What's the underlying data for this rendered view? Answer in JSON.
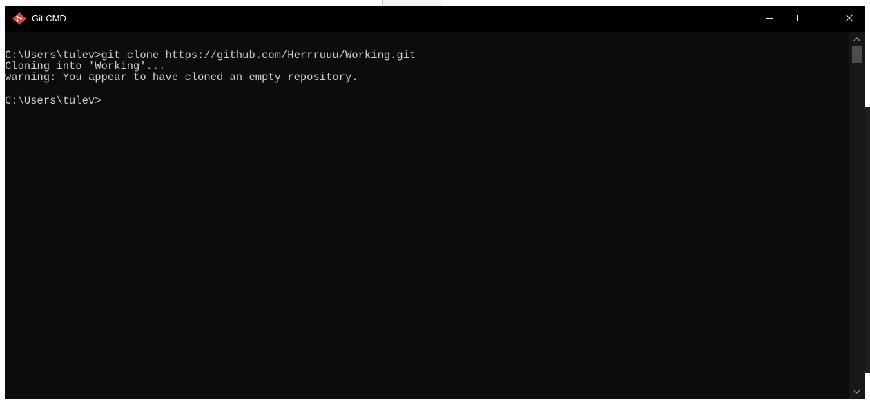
{
  "window": {
    "title": "Git CMD",
    "icon": "git-icon",
    "controls": {
      "minimize": "minimize-icon",
      "maximize": "maximize-icon",
      "close": "close-icon"
    }
  },
  "console": {
    "lines": [
      "C:\\Users\\tulev>git clone https://github.com/Herrruuu/Working.git",
      "Cloning into 'Working'...",
      "warning: You appear to have cloned an empty repository.",
      "",
      "C:\\Users\\tulev>"
    ],
    "text_color": "#cccccc",
    "background": "#0c0c0c"
  },
  "colors": {
    "titlebar": "#000000",
    "git_orange": "#f05033"
  }
}
